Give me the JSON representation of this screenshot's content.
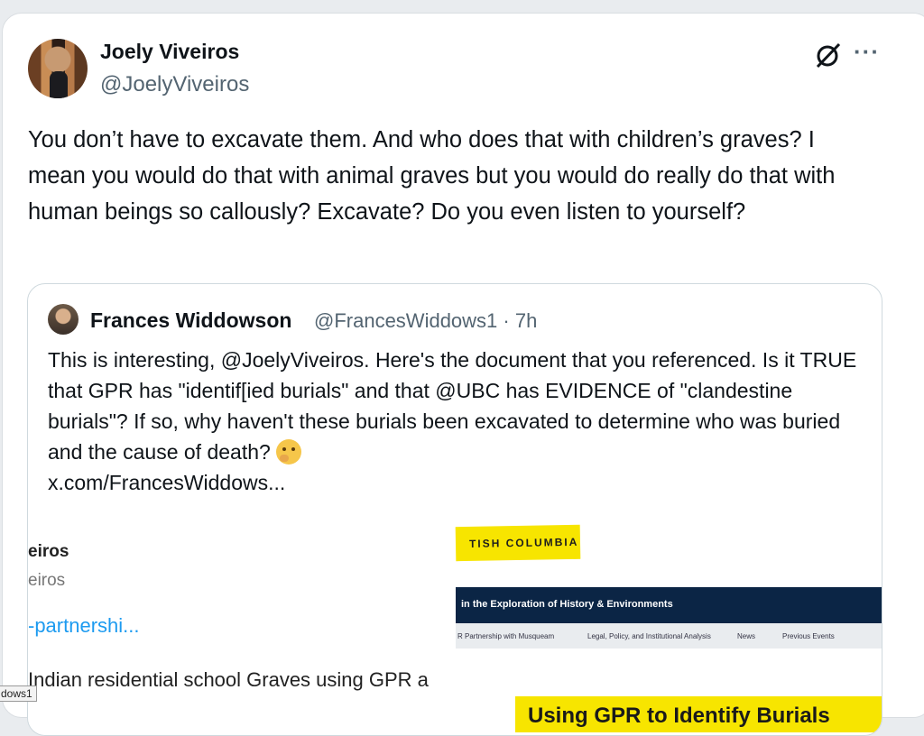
{
  "author": {
    "name": "Joely Viveiros",
    "handle": "@JoelyViveiros"
  },
  "tweet": {
    "text": "You don’t have to excavate them. And who does that with children’s graves? I mean you would do that with animal graves but you would do really do that with human beings so callously? Excavate? Do you even listen to yourself?"
  },
  "menu": {
    "more": "···"
  },
  "quote": {
    "name": "Frances Widdowson",
    "handle_time": "@FrancesWiddows1 · 7h",
    "text": "This is interesting, @JoelyViveiros. Here's the document that you referenced. Is it TRUE that GPR has \"identif[ied burials\" and that @UBC has EVIDENCE of \"clandestine burials\"? If so, why haven't these burials been excavated to determine who was buried and the cause of death?",
    "link": "x.com/FrancesWiddows..."
  },
  "media": {
    "left_title": "eiros",
    "left_handle": "eiros",
    "left_link": "-partnershi...",
    "left_body": "Indian residential school Graves using GPR a",
    "banner": "TISH COLUMBIA",
    "nav": "in the Exploration of History & Environments",
    "subnav": [
      "R Partnership with Musqueam",
      "Legal, Policy, and Institutional Analysis",
      "News",
      "Previous Events"
    ],
    "headline": "Using GPR to Identify Burials"
  },
  "tooltip": "dows1"
}
